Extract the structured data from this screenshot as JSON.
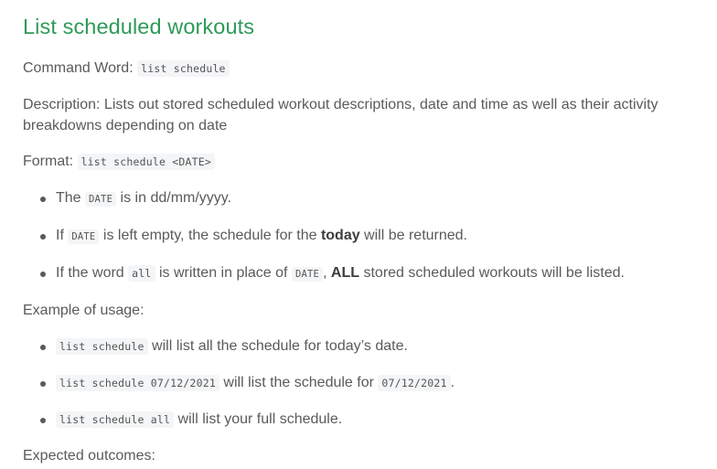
{
  "title": "List scheduled workouts",
  "command": {
    "label": "Command Word: ",
    "code": "list schedule"
  },
  "description": "Description: Lists out stored scheduled workout descriptions, date and time as well as their activity breakdowns depending on date",
  "format": {
    "label": "Format: ",
    "code": "list schedule <DATE>"
  },
  "rules": [
    {
      "pre": "The ",
      "code": "DATE",
      "post": " is in dd/mm/yyyy."
    },
    {
      "pre": "If ",
      "code": "DATE",
      "mid": " is left empty, the schedule for the ",
      "bold": "today",
      "post": " will be returned."
    },
    {
      "pre": "If the word ",
      "code1": "all",
      "mid1": " is written in place of ",
      "code2": "DATE",
      "mid2": ", ",
      "bold": "ALL",
      "post": " stored scheduled workouts will be listed."
    }
  ],
  "example_label": "Example of usage:",
  "examples": [
    {
      "code": "list schedule",
      "post": " will list all the schedule for today’s date."
    },
    {
      "code": "list schedule 07/12/2021",
      "mid": " will list the schedule for ",
      "code2": "07/12/2021",
      "post": "."
    },
    {
      "code": "list schedule all",
      "post": " will list your full schedule."
    }
  ],
  "expected_label": "Expected outcomes:"
}
